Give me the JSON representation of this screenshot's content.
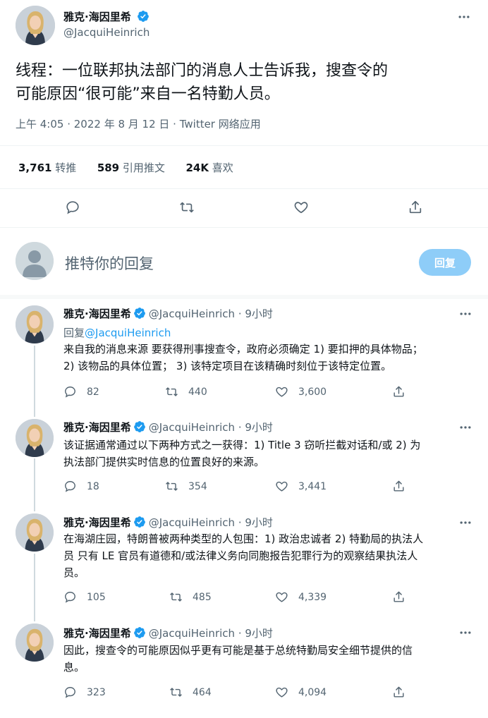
{
  "main_tweet": {
    "author_name": "雅克·海因里希",
    "author_handle": "@JacquiHeinrich",
    "text_line1": "线程：一位联邦执法部门的消息人士告诉我，搜查令的",
    "text_line2": "可能原因“很可能”来自一名特勤人员。",
    "timestamp": "上午 4:05 · 2022 年 8 月 12 日 · Twitter 网络应用",
    "stats": {
      "retweets_num": "3,761",
      "retweets_label": "转推",
      "quotes_num": "589",
      "quotes_label": "引用推文",
      "likes_num": "24K",
      "likes_label": "喜欢"
    }
  },
  "composer": {
    "placeholder": "推特你的回复",
    "button_label": "回复"
  },
  "replies": [
    {
      "name": "雅克·海因里希",
      "handle": "@JacquiHeinrich",
      "time": "9小时",
      "replying_prefix": "回复",
      "replying_to": "@JacquiHeinrich",
      "lines": [
        "来自我的消息来源 要获得刑事搜查令，政府必须确定 1) 要扣押的具体物品；",
        "2) 该物品的具体位置； 3) 该特定项目在该精确时刻位于该特定位置。"
      ],
      "reply_count": "82",
      "retweet_count": "440",
      "like_count": "3,600"
    },
    {
      "name": "雅克·海因里希",
      "handle": "@JacquiHeinrich",
      "time": "9小时",
      "lines": [
        "该证据通常通过以下两种方式之一获得：1) Title 3 窃听拦截对话和/或 2) 为",
        "执法部门提供实时信息的位置良好的来源。"
      ],
      "reply_count": "18",
      "retweet_count": "354",
      "like_count": "3,441"
    },
    {
      "name": "雅克·海因里希",
      "handle": "@JacquiHeinrich",
      "time": "9小时",
      "lines": [
        "在海湖庄园，特朗普被两种类型的人包围：1) 政治忠诚者 2) 特勤局的执法人",
        "员 只有 LE 官员有道德和/或法律义务向同胞报告犯罪行为的观察结果执法人",
        "员。"
      ],
      "reply_count": "105",
      "retweet_count": "485",
      "like_count": "4,339"
    },
    {
      "name": "雅克·海因里希",
      "handle": "@JacquiHeinrich",
      "time": "9小时",
      "lines": [
        "因此，搜查令的可能原因似乎更有可能是基于总统特勤局安全细节提供的信",
        "息。"
      ],
      "reply_count": "323",
      "retweet_count": "464",
      "like_count": "4,094"
    }
  ],
  "colors": {
    "accent": "#1d9bf0",
    "verified": "#1d9bf0",
    "reply_button": "#8ecdf8",
    "muted": "#536471"
  }
}
